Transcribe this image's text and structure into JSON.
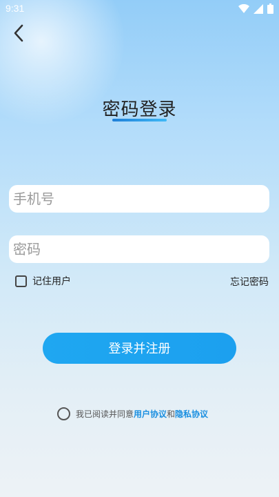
{
  "status_bar": {
    "time": "9:31",
    "icons": [
      "wifi-icon",
      "signal-icon",
      "battery-icon"
    ]
  },
  "header": {
    "back_icon": "chevron-left-icon",
    "title": "密码登录"
  },
  "form": {
    "phone_placeholder": "手机号",
    "phone_value": "",
    "password_placeholder": "密码",
    "password_value": "",
    "remember_label": "记住用户",
    "remember_checked": false,
    "forgot_label": "忘记密码",
    "submit_label": "登录并注册"
  },
  "agreement": {
    "checked": false,
    "prefix": "我已阅读并同意",
    "user_agreement": "用户协议",
    "connector": "和",
    "privacy_policy": "隐私协议"
  },
  "colors": {
    "accent": "#1fa7f1",
    "link": "#1a8fe0",
    "underline_start": "#1e7fd8",
    "underline_end": "#3fb9f6"
  }
}
